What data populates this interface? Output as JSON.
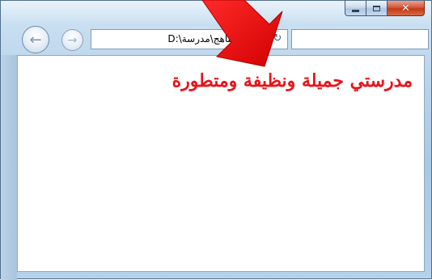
{
  "window": {
    "caption_buttons": {
      "minimize_glyph": "minimize-icon",
      "maximize_glyph": "maximize-icon",
      "close_glyph": "✕"
    }
  },
  "toolbar": {
    "back_icon": "←",
    "forward_icon": "→",
    "address": "D:\\ع ثانية\\مناهج\\مدرسة",
    "refresh_icon": "↻",
    "search_value": ""
  },
  "page": {
    "heading": "مدرستي جميلة ونظيفة ومتطورة"
  },
  "annotation": {
    "arrow_color": "#ff0000",
    "arrow_icon": "arrow-down-left-icon"
  },
  "colors": {
    "heading": "#e8141b",
    "close_button": "#d7583a"
  }
}
